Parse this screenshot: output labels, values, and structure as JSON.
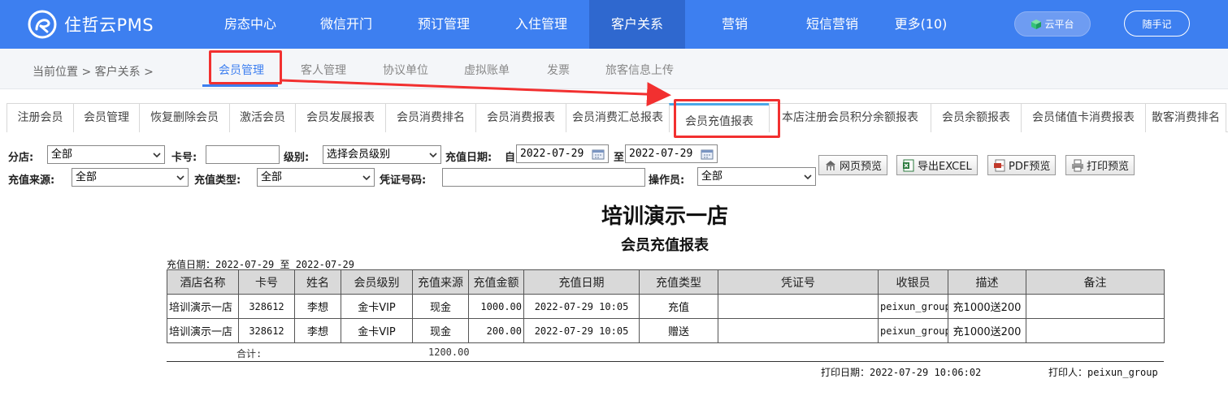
{
  "brand": {
    "name": "住哲云PMS"
  },
  "nav": [
    {
      "label": "房态中心",
      "w": 118
    },
    {
      "label": "微信开门",
      "w": 118
    },
    {
      "label": "预订管理",
      "w": 122
    },
    {
      "label": "入住管理",
      "w": 118
    },
    {
      "label": "客户关系",
      "w": 118
    },
    {
      "label": "营销",
      "w": 122
    },
    {
      "label": "短信营销",
      "w": 118
    },
    {
      "label": "更多(10)",
      "w": 100
    }
  ],
  "top_buttons": {
    "cloud": "云平台",
    "note": "随手记"
  },
  "breadcrumb": "当前位置 > 客户关系 >",
  "subtabs": [
    "会员管理",
    "客人管理",
    "协议单位",
    "虚拟账单",
    "发票",
    "旅客信息上传"
  ],
  "tabs": [
    "注册会员",
    "会员管理",
    "恢复删除会员",
    "激活会员",
    "会员发展报表",
    "会员消费排名",
    "会员消费报表",
    "会员消费汇总报表",
    "会员充值报表",
    "本店注册会员积分余额报表",
    "会员余额报表",
    "会员储值卡消费报表",
    "散客消费排名"
  ],
  "filters": {
    "branch_label": "分店:",
    "branch_value": "全部",
    "card_label": "卡号:",
    "card_value": "",
    "level_label": "级别:",
    "level_value": "选择会员级别",
    "date_label": "充值日期:",
    "from_label": "自",
    "from_value": "2022-07-29",
    "to_label": "至",
    "to_value": "2022-07-29",
    "source_label": "充值来源:",
    "source_value": "全部",
    "type_label": "充值类型:",
    "type_value": "全部",
    "voucher_label": "凭证号码:",
    "voucher_value": "",
    "operator_label": "操作员:",
    "operator_value": "全部"
  },
  "toolbar": {
    "web_preview": "网页预览",
    "export_excel": "导出EXCEL",
    "pdf_preview": "PDF预览",
    "print_preview": "打印预览"
  },
  "report": {
    "title": "培训演示一店",
    "subtitle": "会员充值报表",
    "range": "充值日期：2022-07-29 至 2022-07-29",
    "columns": [
      "酒店名称",
      "卡号",
      "姓名",
      "会员级别",
      "充值来源",
      "充值金额",
      "充值日期",
      "充值类型",
      "凭证号",
      "收银员",
      "描述",
      "备注"
    ],
    "rows": [
      [
        "培训演示一店",
        "328612",
        "李想",
        "金卡VIP",
        "现金",
        "1000.00",
        "2022-07-29 10:05",
        "充值",
        "",
        "peixun_group",
        "充1000送200",
        ""
      ],
      [
        "培训演示一店",
        "328612",
        "李想",
        "金卡VIP",
        "现金",
        "200.00",
        "2022-07-29 10:05",
        "赠送",
        "",
        "peixun_group",
        "充1000送200",
        ""
      ]
    ],
    "total_label": "合计:",
    "total_value": "1200.00",
    "print_date": "打印日期：2022-07-29 10:06:02",
    "printer": "打印人：peixun_group"
  }
}
